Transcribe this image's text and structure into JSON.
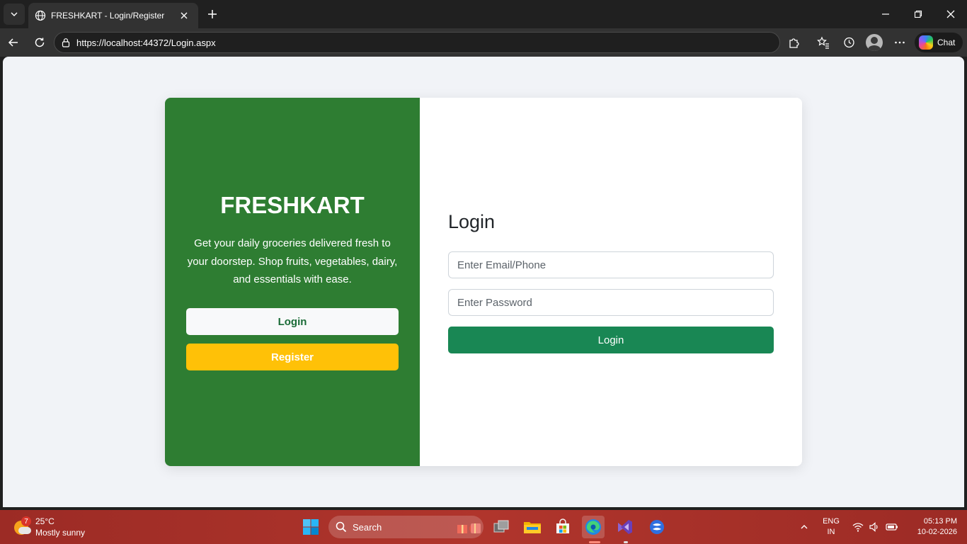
{
  "browser": {
    "tab_title": "FRESHKART - Login/Register",
    "url": "https://localhost:44372/Login.aspx",
    "chat_label": "Chat"
  },
  "page": {
    "brand": "FRESHKART",
    "tagline": "Get your daily groceries delivered fresh to your doorstep. Shop fruits, vegetables, dairy, and essentials with ease.",
    "side_login_label": "Login",
    "side_register_label": "Register",
    "form_title": "Login",
    "email_placeholder": "Enter Email/Phone",
    "password_placeholder": "Enter Password",
    "submit_label": "Login"
  },
  "colors": {
    "left_panel": "#2e7d32",
    "register_button": "#ffc107",
    "submit_button": "#198754",
    "page_background": "#f1f3f7"
  },
  "taskbar": {
    "weather_badge": "7",
    "temperature": "25°C",
    "condition": "Mostly sunny",
    "search_label": "Search",
    "lang_line1": "ENG",
    "lang_line2": "IN",
    "time": "05:13 PM",
    "date": "10-02-2026",
    "icons": [
      "windows-start-icon",
      "search-icon",
      "gift-icon",
      "task-view-icon",
      "file-explorer-icon",
      "microsoft-store-icon",
      "edge-icon",
      "visual-studio-icon",
      "app-icon",
      "chevron-up-icon",
      "wifi-icon",
      "volume-icon",
      "battery-icon"
    ]
  }
}
